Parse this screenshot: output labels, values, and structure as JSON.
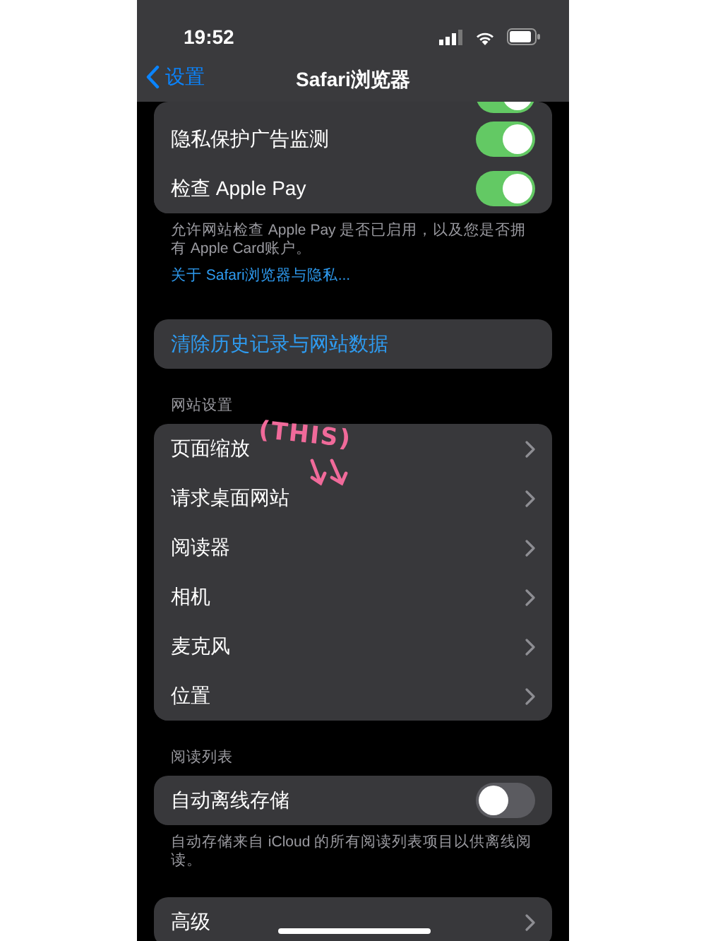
{
  "status_bar": {
    "time": "19:52"
  },
  "nav": {
    "back": "设置",
    "title": "Safari浏览器"
  },
  "sections": [
    {
      "rows": [
        {
          "kind": "toggle",
          "on": true
        },
        {
          "kind": "toggle",
          "label": "隐私保护广告监测",
          "on": true
        },
        {
          "kind": "toggle",
          "label": "检查 Apple Pay",
          "on": true
        }
      ],
      "footer": "允许网站检查 Apple Pay 是否已启用，以及您是否拥有 Apple Card账户。",
      "footer_link": "关于 Safari浏览器与隐私..."
    },
    {
      "rows": [
        {
          "kind": "action",
          "label": "清除历史记录与网站数据"
        }
      ]
    },
    {
      "header": "网站设置",
      "rows": [
        {
          "kind": "link",
          "label": "页面缩放"
        },
        {
          "kind": "link",
          "label": "请求桌面网站"
        },
        {
          "kind": "link",
          "label": "阅读器"
        },
        {
          "kind": "link",
          "label": "相机"
        },
        {
          "kind": "link",
          "label": "麦克风"
        },
        {
          "kind": "link",
          "label": "位置"
        }
      ]
    },
    {
      "header": "阅读列表",
      "rows": [
        {
          "kind": "toggle",
          "label": "自动离线存储",
          "on": false
        }
      ],
      "footer": "自动存储来自 iCloud 的所有阅读列表项目以供离线阅读。"
    },
    {
      "rows": [
        {
          "kind": "link",
          "label": "高级"
        }
      ]
    }
  ],
  "annotation": {
    "text": "(THIS)"
  }
}
